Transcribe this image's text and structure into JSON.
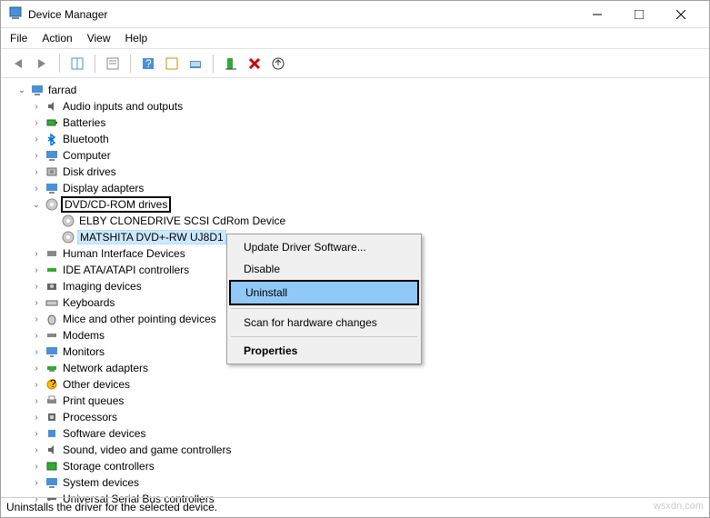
{
  "window": {
    "title": "Device Manager"
  },
  "menu": {
    "file": "File",
    "action": "Action",
    "view": "View",
    "help": "Help"
  },
  "tree": {
    "root": "farrad",
    "items": [
      "Audio inputs and outputs",
      "Batteries",
      "Bluetooth",
      "Computer",
      "Disk drives",
      "Display adapters"
    ],
    "dvd": {
      "label": "DVD/CD-ROM drives",
      "children": [
        "ELBY CLONEDRIVE SCSI CdRom Device",
        "MATSHITA DVD+-RW UJ8D1"
      ]
    },
    "rest": [
      "Human Interface Devices",
      "IDE ATA/ATAPI controllers",
      "Imaging devices",
      "Keyboards",
      "Mice and other pointing devices",
      "Modems",
      "Monitors",
      "Network adapters",
      "Other devices",
      "Print queues",
      "Processors",
      "Software devices",
      "Sound, video and game controllers",
      "Storage controllers",
      "System devices",
      "Universal Serial Bus controllers"
    ]
  },
  "context": {
    "update": "Update Driver Software...",
    "disable": "Disable",
    "uninstall": "Uninstall",
    "scan": "Scan for hardware changes",
    "properties": "Properties"
  },
  "status": "Uninstalls the driver for the selected device.",
  "watermark": "wsxdn.com"
}
